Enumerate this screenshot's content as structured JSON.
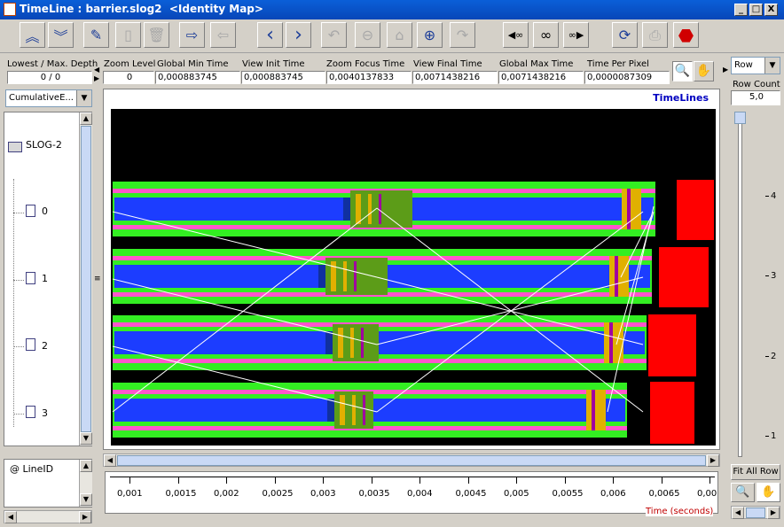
{
  "window": {
    "title": "TimeLine : barrier.slog2  <Identity Map>",
    "minimize": "_",
    "maximize": "□",
    "close": "X"
  },
  "toolbar": {
    "buttons": [
      {
        "name": "up-button",
        "glyph": "︽"
      },
      {
        "name": "down-button",
        "glyph": "︾"
      },
      {
        "name": "edit-button",
        "glyph": "✎"
      },
      {
        "name": "copy-button",
        "glyph": "▯"
      },
      {
        "name": "delete-button",
        "glyph": "🗑"
      },
      {
        "name": "export-button",
        "glyph": "⇨"
      },
      {
        "name": "import-button",
        "glyph": "⇦"
      },
      {
        "name": "scroll-left-button",
        "glyph": "‹"
      },
      {
        "name": "scroll-right-button",
        "glyph": "›"
      },
      {
        "name": "undo-button",
        "glyph": "↶"
      },
      {
        "name": "zoom-out-button",
        "glyph": "⊖"
      },
      {
        "name": "home-button",
        "glyph": "⌂"
      },
      {
        "name": "zoom-in-button",
        "glyph": "⊕"
      },
      {
        "name": "redo-button",
        "glyph": "↷"
      },
      {
        "name": "search-back-button",
        "glyph": "◀∞"
      },
      {
        "name": "search-init-button",
        "glyph": "∞"
      },
      {
        "name": "search-forward-button",
        "glyph": "∞▶"
      },
      {
        "name": "refresh-button",
        "glyph": "⟳"
      },
      {
        "name": "print-button",
        "glyph": "⎙"
      },
      {
        "name": "stop-button",
        "glyph": "⬣"
      }
    ]
  },
  "fields": {
    "lowest_max_depth": {
      "label": "Lowest / Max. Depth",
      "value": "0 / 0"
    },
    "zoom_level": {
      "label": "Zoom Level",
      "value": "0"
    },
    "global_min_time": {
      "label": "Global Min Time",
      "value": "0,000883745"
    },
    "view_init_time": {
      "label": "View  Init Time",
      "value": "0,000883745"
    },
    "zoom_focus_time": {
      "label": "Zoom Focus Time",
      "value": "0,0040137833"
    },
    "view_final_time": {
      "label": "View Final Time",
      "value": "0,0071438216"
    },
    "global_max_time": {
      "label": "Global Max Time",
      "value": "0,0071438216"
    },
    "time_per_pixel": {
      "label": "Time Per Pixel",
      "value": "0,0000087309"
    }
  },
  "left_panel": {
    "combo_value": "CumulativeE...",
    "root": "SLOG-2",
    "rows": [
      "0",
      "1",
      "2",
      "3"
    ],
    "line_id_label": "@ LineID"
  },
  "timelines": {
    "title": "TimeLines",
    "axis_label": "Time (seconds)",
    "axis_ticks": [
      "0,001",
      "0,0015",
      "0,002",
      "0,0025",
      "0,003",
      "0,0035",
      "0,004",
      "0,0045",
      "0,005",
      "0,0055",
      "0,006",
      "0,0065",
      "0,00"
    ]
  },
  "right_panel": {
    "combo_value": "Row",
    "row_count_label": "Row Count",
    "row_count_value": "5,0",
    "slider_ticks": [
      "4",
      "3",
      "2",
      "1"
    ],
    "fit_all_label": "Fit All Row"
  },
  "colors": {
    "canvas_bg": "#000000",
    "state_blue": "#1c3dff",
    "state_green": "#33ee22",
    "state_magenta": "#ff55cc",
    "state_red": "#ff0000",
    "title_blue": "#0a5fd8"
  }
}
